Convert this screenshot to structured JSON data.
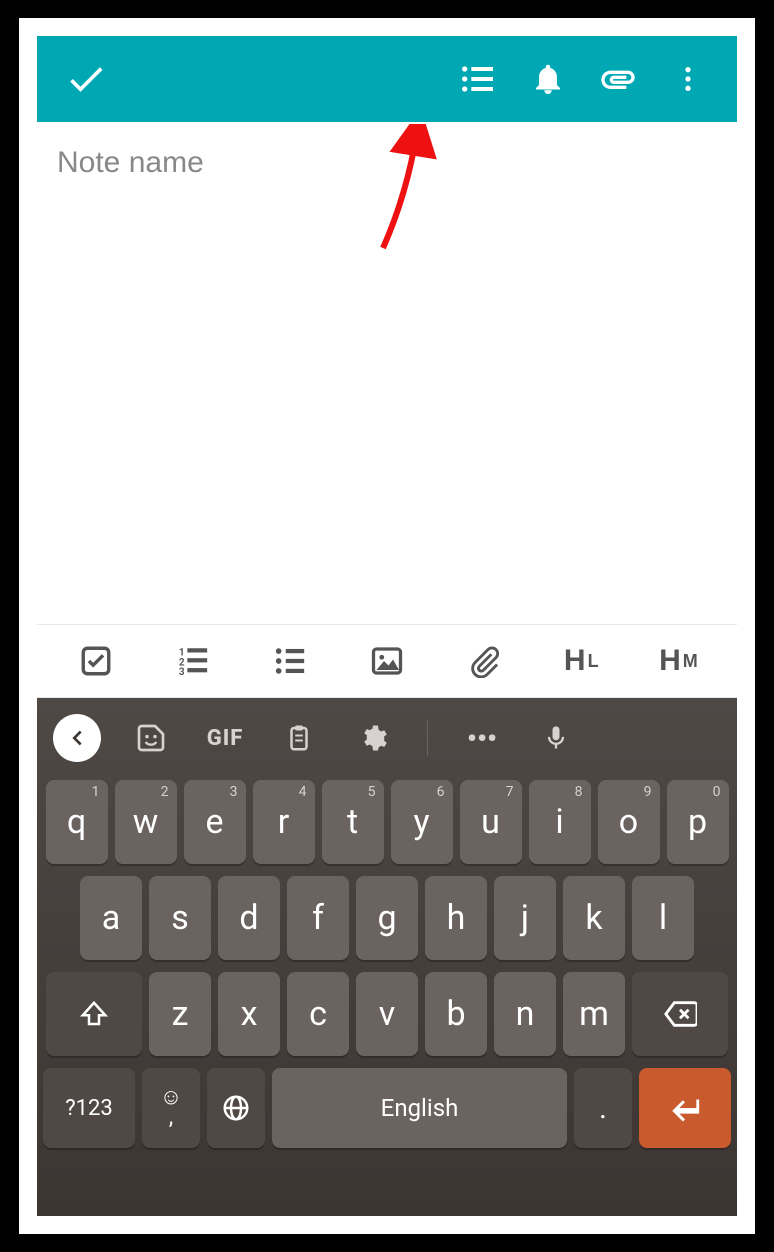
{
  "appbar": {
    "accent": "#00a8b4",
    "icons": {
      "done": "check-icon",
      "list": "list-icon",
      "reminder": "bell-icon",
      "attach": "attachment-icon",
      "overflow": "more-vert-icon"
    }
  },
  "note": {
    "title_placeholder": "Note name",
    "title_value": "",
    "body_value": ""
  },
  "format_bar": {
    "items": [
      "checkbox",
      "ordered-list",
      "bullet-list",
      "image",
      "attachment",
      "heading-large",
      "heading-medium"
    ],
    "heading_large_label_big": "H",
    "heading_large_label_small": "L",
    "heading_medium_label_big": "H",
    "heading_medium_label_small": "M"
  },
  "keyboard": {
    "toprow": {
      "gif_label": "GIF",
      "more_label": "•••"
    },
    "row1": [
      {
        "k": "q",
        "n": "1"
      },
      {
        "k": "w",
        "n": "2"
      },
      {
        "k": "e",
        "n": "3"
      },
      {
        "k": "r",
        "n": "4"
      },
      {
        "k": "t",
        "n": "5"
      },
      {
        "k": "y",
        "n": "6"
      },
      {
        "k": "u",
        "n": "7"
      },
      {
        "k": "i",
        "n": "8"
      },
      {
        "k": "o",
        "n": "9"
      },
      {
        "k": "p",
        "n": "0"
      }
    ],
    "row2": [
      "a",
      "s",
      "d",
      "f",
      "g",
      "h",
      "j",
      "k",
      "l"
    ],
    "row3": [
      "z",
      "x",
      "c",
      "v",
      "b",
      "n",
      "m"
    ],
    "symbols_label": "?123",
    "space_label": "English",
    "comma_label": ",",
    "period_label": ".",
    "emoji_glyph": "☺"
  }
}
